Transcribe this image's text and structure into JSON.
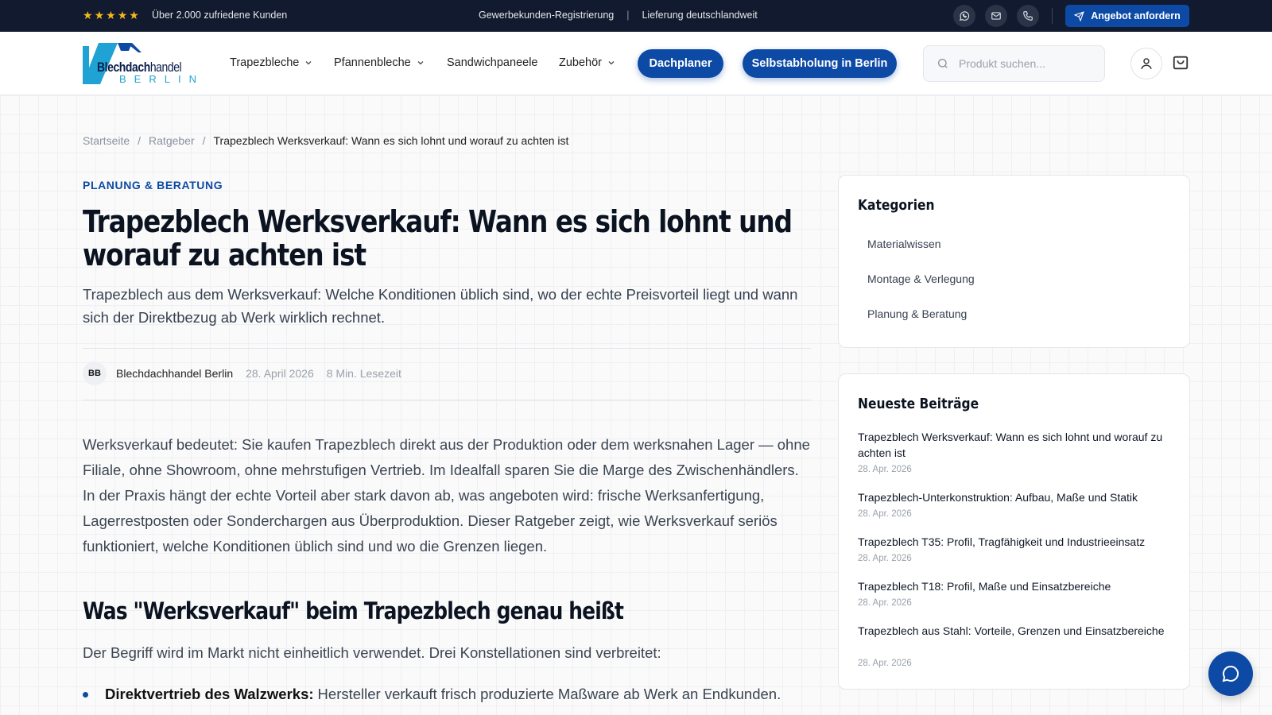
{
  "topbar": {
    "rating_icon": "star-icon",
    "star_count": 5,
    "rating_text": "Über 2.000 zufriedene Kunden",
    "link_registration": "Gewerbekunden-Registrierung",
    "separator": "|",
    "link_delivery": "Lieferung deutschlandweit",
    "offer_button": "Angebot anfordern"
  },
  "logo": {
    "line1_a": "Blechdach",
    "line1_b": "handel",
    "line2": "BERLIN"
  },
  "nav": {
    "trapezbleche": "Trapezbleche",
    "pfannenbleche": "Pfannenbleche",
    "sandwichpaneele": "Sandwichpaneele",
    "zubehoer": "Zubehör",
    "dachplaner": "Dachplaner",
    "selbstabholung": "Selbstabholung in Berlin"
  },
  "search": {
    "placeholder": "Produkt suchen..."
  },
  "breadcrumb": {
    "home": "Startseite",
    "sep": "/",
    "ratgeber": "Ratgeber",
    "current": "Trapezblech Werksverkauf: Wann es sich lohnt und worauf zu achten ist"
  },
  "article": {
    "category": "PLANUNG & BERATUNG",
    "title": "Trapezblech Werksverkauf: Wann es sich lohnt und worauf zu achten ist",
    "lead": "Trapezblech aus dem Werksverkauf: Welche Konditionen üblich sind, wo der echte Preisvorteil liegt und wann sich der Direktbezug ab Werk wirklich rechnet.",
    "author_initials": "BB",
    "author": "Blechdachhandel Berlin",
    "date": "28. April 2026",
    "reading_time": "8 Min. Lesezeit",
    "body": "Werksverkauf bedeutet: Sie kaufen Trapezblech direkt aus der Produktion oder dem werksnahen Lager — ohne Filiale, ohne Showroom, ohne mehrstufigen Vertrieb. Im Idealfall sparen Sie die Marge des Zwischenhändlers. In der Praxis hängt der echte Vorteil aber stark davon ab, was angeboten wird: frische Werksanfertigung, Lagerrestposten oder Sonderchargen aus Überproduktion. Dieser Ratgeber zeigt, wie Werksverkauf seriös funktioniert, welche Konditionen üblich sind und wo die Grenzen liegen.",
    "h2": "Was \"Werksverkauf\" beim Trapezblech genau heißt",
    "para2": "Der Begriff wird im Markt nicht einheitlich verwendet. Drei Konstellationen sind verbreitet:",
    "bullet1_bold": "Direktvertrieb des Walzwerks:",
    "bullet1_text": "Hersteller verkauft frisch produzierte Maßware ab Werk an Endkunden."
  },
  "sidebar": {
    "categories_title": "Kategorien",
    "categories": [
      "Materialwissen",
      "Montage & Verlegung",
      "Planung & Beratung"
    ],
    "recent_title": "Neueste Beiträge",
    "posts": [
      {
        "title": "Trapezblech Werksverkauf: Wann es sich lohnt und worauf zu achten ist",
        "date": "28. Apr. 2026"
      },
      {
        "title": "Trapezblech-Unterkonstruktion: Aufbau, Maße und Statik",
        "date": "28. Apr. 2026"
      },
      {
        "title": "Trapezblech T35: Profil, Tragfähigkeit und Industrieeinsatz",
        "date": "28. Apr. 2026"
      },
      {
        "title": "Trapezblech T18: Profil, Maße und Einsatzbereiche",
        "date": "28. Apr. 2026"
      },
      {
        "title": "Trapezblech aus Stahl: Vorteile, Grenzen und Einsatzbereiche",
        "date": "28. Apr. 2026"
      }
    ]
  },
  "colors": {
    "brand_blue": "#0d4aa5",
    "topbar_bg": "#111a2e",
    "star": "#f5b71b",
    "logo_cyan": "#1fa3d4"
  },
  "icons": [
    "star-icon",
    "whatsapp-icon",
    "mail-icon",
    "phone-icon",
    "send-icon",
    "chevron-down-icon",
    "search-icon",
    "user-icon",
    "cart-icon",
    "chat-icon"
  ]
}
